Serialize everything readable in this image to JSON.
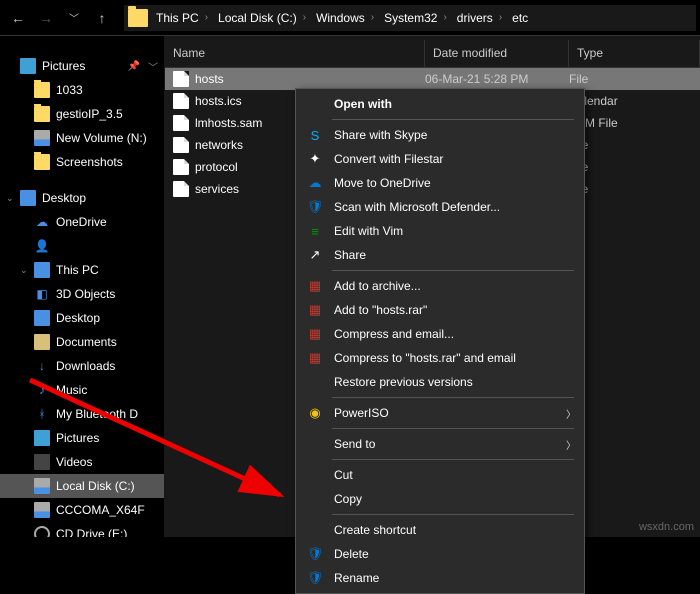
{
  "nav": {
    "crumbs": [
      "This PC",
      "Local Disk (C:)",
      "Windows",
      "System32",
      "drivers",
      "etc"
    ]
  },
  "sidebar": {
    "qa_top": {
      "label": "Pictures",
      "icon": "pictures"
    },
    "qa": [
      {
        "label": "1033",
        "icon": "folder"
      },
      {
        "label": "gestioIP_3.5",
        "icon": "folder"
      },
      {
        "label": "New Volume (N:)",
        "icon": "drive"
      },
      {
        "label": "Screenshots",
        "icon": "folder"
      }
    ],
    "desktop_label": "Desktop",
    "desktop_children": [
      {
        "label": "OneDrive",
        "icon": "onedrive"
      },
      {
        "label": "",
        "icon": "user"
      },
      {
        "label": "This PC",
        "icon": "pc",
        "expanded": true
      }
    ],
    "thispc_children": [
      {
        "label": "3D Objects",
        "icon": "3d"
      },
      {
        "label": "Desktop",
        "icon": "desktop"
      },
      {
        "label": "Documents",
        "icon": "doc"
      },
      {
        "label": "Downloads",
        "icon": "dl"
      },
      {
        "label": "Music",
        "icon": "music"
      },
      {
        "label": "My Bluetooth D",
        "icon": "bt"
      },
      {
        "label": "Pictures",
        "icon": "pictures"
      },
      {
        "label": "Videos",
        "icon": "video"
      },
      {
        "label": "Local Disk (C:)",
        "icon": "drive",
        "selected": true
      },
      {
        "label": "CCCOMA_X64F",
        "icon": "drive"
      },
      {
        "label": "CD Drive (E:)",
        "icon": "cd"
      }
    ]
  },
  "columns": {
    "name": "Name",
    "date": "Date modified",
    "type": "Type"
  },
  "files": [
    {
      "name": "hosts",
      "date": "06-Mar-21 5:28 PM",
      "type": "File",
      "selected": true
    },
    {
      "name": "hosts.ics",
      "date": "",
      "type": "Calendar"
    },
    {
      "name": "lmhosts.sam",
      "date": "",
      "type": "SAM File"
    },
    {
      "name": "networks",
      "date": "",
      "type": "File"
    },
    {
      "name": "protocol",
      "date": "",
      "type": "File"
    },
    {
      "name": "services",
      "date": "",
      "type": "File"
    }
  ],
  "ctx": [
    {
      "label": "Open with",
      "bold": true,
      "sep_after": true
    },
    {
      "label": "Share with Skype",
      "icon": "skype"
    },
    {
      "label": "Convert with Filestar",
      "icon": "filestar"
    },
    {
      "label": "Move to OneDrive",
      "icon": "onedrive"
    },
    {
      "label": "Scan with Microsoft Defender...",
      "icon": "defender"
    },
    {
      "label": "Edit with Vim",
      "icon": "vim"
    },
    {
      "label": "Share",
      "icon": "share",
      "sep_after": true
    },
    {
      "label": "Add to archive...",
      "icon": "rar"
    },
    {
      "label": "Add to \"hosts.rar\"",
      "icon": "rar"
    },
    {
      "label": "Compress and email...",
      "icon": "rar"
    },
    {
      "label": "Compress to \"hosts.rar\" and email",
      "icon": "rar"
    },
    {
      "label": "Restore previous versions",
      "sep_after": true
    },
    {
      "label": "PowerISO",
      "icon": "poweriso",
      "arrow": true,
      "sep_after": true
    },
    {
      "label": "Send to",
      "arrow": true,
      "sep_after": true
    },
    {
      "label": "Cut"
    },
    {
      "label": "Copy",
      "sep_after": true
    },
    {
      "label": "Create shortcut"
    },
    {
      "label": "Delete",
      "icon": "shield"
    },
    {
      "label": "Rename",
      "icon": "shield"
    }
  ],
  "watermark": "wsxdn.com"
}
